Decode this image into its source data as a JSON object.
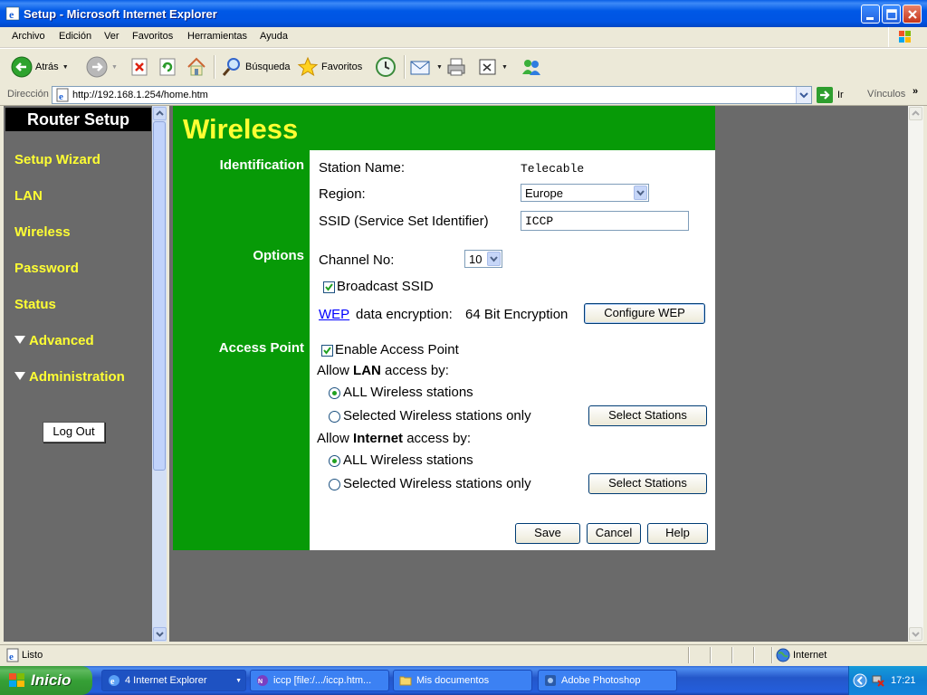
{
  "window": {
    "title": "Setup - Microsoft Internet Explorer"
  },
  "menu": [
    "Archivo",
    "Edición",
    "Ver",
    "Favoritos",
    "Herramientas",
    "Ayuda"
  ],
  "toolbar": {
    "back_label": "Atrás",
    "search_label": "Búsqueda",
    "favorites_label": "Favoritos"
  },
  "address": {
    "label": "Dirección",
    "url": "http://192.168.1.254/home.htm",
    "go_label": "Ir",
    "links_label": "Vínculos"
  },
  "sidebar": {
    "brand": "Router Setup",
    "items": [
      {
        "label": "Setup Wizard"
      },
      {
        "label": "LAN"
      },
      {
        "label": "Wireless"
      },
      {
        "label": "Password"
      },
      {
        "label": "Status"
      },
      {
        "label": "Advanced"
      },
      {
        "label": "Administration"
      }
    ],
    "logout_label": "Log Out"
  },
  "page": {
    "title": "Wireless",
    "sections": {
      "identification": "Identification",
      "options": "Options",
      "access_point": "Access Point"
    },
    "station_name_label": "Station Name:",
    "station_name_value": "Telecable",
    "region_label": "Region:",
    "region_value": "Europe",
    "ssid_label": "SSID (Service Set Identifier)",
    "ssid_value": "ICCP",
    "channel_label": "Channel No:",
    "channel_value": "10",
    "broadcast_ssid_label": "Broadcast SSID",
    "broadcast_ssid_checked": true,
    "wep_link": "WEP",
    "wep_text": "data encryption:",
    "wep_value": "64 Bit Encryption",
    "configure_wep_label": "Configure WEP",
    "enable_ap_label": "Enable Access Point",
    "enable_ap_checked": true,
    "allow_lan_prefix": "Allow",
    "allow_lan_bold": "LAN",
    "allow_lan_suffix": "access by:",
    "allow_internet_prefix": "Allow",
    "allow_internet_bold": "Internet",
    "allow_internet_suffix": "access by:",
    "all_stations_label": "ALL Wireless stations",
    "selected_stations_label": "Selected Wireless stations only",
    "select_stations_label": "Select Stations",
    "save_label": "Save",
    "cancel_label": "Cancel",
    "help_label": "Help"
  },
  "statusbar": {
    "status": "Listo",
    "zone": "Internet"
  },
  "taskbar": {
    "start_label": "Inicio",
    "tasks": [
      {
        "label": "4 Internet Explorer"
      },
      {
        "label": "iccp [file:/.../iccp.htm..."
      },
      {
        "label": "Mis documentos"
      },
      {
        "label": "Adobe Photoshop"
      }
    ],
    "clock": "17:21"
  },
  "colors": {
    "page_green": "#079a07",
    "heading_yellow": "#ffff33",
    "frame_gray": "#6a6a6a"
  }
}
